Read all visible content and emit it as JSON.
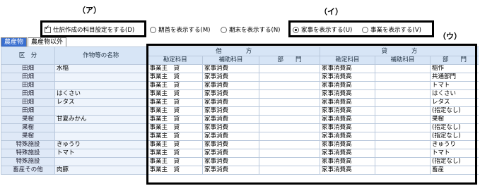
{
  "callouts": {
    "a": "（ア）",
    "i": "（イ）",
    "u": "（ウ）"
  },
  "options": {
    "journal_setting": {
      "label": "仕訳作成の科目設定をする(D)",
      "checked": true
    },
    "show_beginning": {
      "label": "期首を表示する(M)",
      "selected": false
    },
    "show_end": {
      "label": "期末を表示する(N)",
      "selected": false
    },
    "show_household": {
      "label": "家事を表示する(U)",
      "selected": true
    },
    "show_business": {
      "label": "事業を表示する(V)",
      "selected": false
    }
  },
  "tabs": [
    {
      "label": "農産物",
      "active": true
    },
    {
      "label": "農産物以外",
      "active": false
    }
  ],
  "table": {
    "headers": {
      "category": "区　分",
      "name": "作物等の名称",
      "debit": "借　　　　方",
      "credit": "貸　　　　方",
      "account": "勘定科目",
      "sub_account": "補助科目",
      "dept": "部　　門"
    },
    "rows": [
      {
        "category": "田畑",
        "name": "水稲",
        "d_account": "事業主　貸",
        "d_sub": "家事消費",
        "d_dept": "",
        "c_account": "家事消費高",
        "c_sub": "",
        "c_dept": "稲作"
      },
      {
        "category": "田畑",
        "name": "",
        "d_account": "事業主　貸",
        "d_sub": "家事消費",
        "d_dept": "",
        "c_account": "家事消費高",
        "c_sub": "",
        "c_dept": "共通部門"
      },
      {
        "category": "田畑",
        "name": "",
        "d_account": "事業主　貸",
        "d_sub": "家事消費",
        "d_dept": "",
        "c_account": "家事消費高",
        "c_sub": "",
        "c_dept": "トマト"
      },
      {
        "category": "田畑",
        "name": "はくさい",
        "d_account": "事業主　貸",
        "d_sub": "家事消費",
        "d_dept": "",
        "c_account": "家事消費高",
        "c_sub": "",
        "c_dept": "はくさい"
      },
      {
        "category": "田畑",
        "name": "レタス",
        "d_account": "事業主　貸",
        "d_sub": "家事消費",
        "d_dept": "",
        "c_account": "家事消費高",
        "c_sub": "",
        "c_dept": "レタス"
      },
      {
        "category": "田畑",
        "name": "",
        "d_account": "事業主　貸",
        "d_sub": "家事消費",
        "d_dept": "",
        "c_account": "家事消費高",
        "c_sub": "",
        "c_dept": "(指定なし)"
      },
      {
        "category": "果樹",
        "name": "甘夏みかん",
        "d_account": "事業主　貸",
        "d_sub": "家事消費",
        "d_dept": "",
        "c_account": "家事消費高",
        "c_sub": "",
        "c_dept": "果樹"
      },
      {
        "category": "果樹",
        "name": "",
        "d_account": "事業主　貸",
        "d_sub": "家事消費",
        "d_dept": "",
        "c_account": "家事消費高",
        "c_sub": "",
        "c_dept": "(指定なし)"
      },
      {
        "category": "果樹",
        "name": "",
        "d_account": "事業主　貸",
        "d_sub": "家事消費",
        "d_dept": "",
        "c_account": "家事消費高",
        "c_sub": "",
        "c_dept": "(指定なし)"
      },
      {
        "category": "特殊施設",
        "name": "きゅうり",
        "d_account": "事業主　貸",
        "d_sub": "家事消費",
        "d_dept": "",
        "c_account": "家事消費高",
        "c_sub": "",
        "c_dept": "きゅうり"
      },
      {
        "category": "特殊施設",
        "name": "トマト",
        "d_account": "事業主　貸",
        "d_sub": "家事消費",
        "d_dept": "",
        "c_account": "家事消費高",
        "c_sub": "",
        "c_dept": "トマト"
      },
      {
        "category": "特殊施設",
        "name": "",
        "d_account": "事業主　貸",
        "d_sub": "家事消費",
        "d_dept": "",
        "c_account": "家事消費高",
        "c_sub": "",
        "c_dept": "(指定なし)"
      },
      {
        "category": "畜産その他",
        "name": "肉豚",
        "d_account": "事業主　貸",
        "d_sub": "家事消費",
        "d_dept": "",
        "c_account": "家事消費高",
        "c_sub": "",
        "c_dept": "畜産"
      }
    ]
  }
}
